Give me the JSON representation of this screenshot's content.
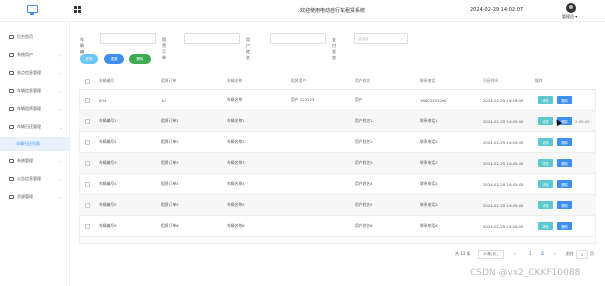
{
  "header": {
    "title": "欢迎使用电动自行车租赁系统",
    "datetime": "2024-02-29 14:02:07",
    "user": "管理员 ▾"
  },
  "sidebar": {
    "items": [
      {
        "label": "后台首页",
        "icon": "home-icon"
      },
      {
        "label": "系统用户",
        "icon": "user-icon",
        "arrow": "›"
      },
      {
        "label": "站点信息管理",
        "icon": "site-icon",
        "arrow": "›"
      },
      {
        "label": "车辆信息管理",
        "icon": "bike-icon",
        "arrow": "›"
      },
      {
        "label": "车辆租赁管理",
        "icon": "rent-icon",
        "arrow": "›"
      },
      {
        "label": "车辆归还管理",
        "icon": "return-icon",
        "arrow": "⌄"
      },
      {
        "label": "车辆归还列表",
        "sub": true
      },
      {
        "label": "系统管理",
        "icon": "settings-icon",
        "arrow": "›"
      },
      {
        "label": "公告信息管理",
        "icon": "notice-icon",
        "arrow": "›"
      },
      {
        "label": "资源管理",
        "icon": "resource-icon",
        "arrow": "›"
      }
    ]
  },
  "filters": {
    "vehicle_no_label": "车辆编号",
    "rent_no_label": "租赁订单",
    "username_label": "用户姓名",
    "pay_status_label": "支付状态",
    "pay_status_placeholder": "请选择"
  },
  "buttons": {
    "search": "查询",
    "reset": "重置",
    "delete": "删除"
  },
  "table": {
    "headers": [
      "车辆编号",
      "租赁订单",
      "车辆名称",
      "租赁用户",
      "用户姓名",
      "联系电话",
      "归还时间",
      "操作"
    ],
    "edit_label": "详情",
    "delete_label": "删除",
    "rows": [
      [
        "E04",
        "10",
        "车辆名称",
        "用户 123123",
        "用户",
        "18603253290",
        "2024-02-29 14:49:00"
      ],
      [
        "车辆编号1",
        "租赁订单1",
        "车辆名称1",
        "",
        "用户姓名1",
        "联系电话1",
        "2024-02-29 14:45:45"
      ],
      [
        "车辆编号2",
        "租赁订单2",
        "车辆名称2",
        "",
        "用户姓名2",
        "联系电话2",
        "2024-02-29 14:45:45"
      ],
      [
        "车辆编号3",
        "租赁订单3",
        "车辆名称3",
        "",
        "用户姓名3",
        "联系电话3",
        "2024-02-29 14:45:45"
      ],
      [
        "车辆编号4",
        "租赁订单4",
        "车辆名称4",
        "",
        "用户姓名4",
        "联系电话4",
        "2024-02-29 14:45:45"
      ],
      [
        "车辆编号5",
        "租赁订单5",
        "车辆名称5",
        "",
        "用户姓名5",
        "联系电话5",
        "2024-02-29 14:45:45"
      ],
      [
        "车辆编号6",
        "租赁订单6",
        "车辆名称6",
        "",
        "用户姓名6",
        "联系电话6",
        "2024-02-29 14:45:45"
      ]
    ],
    "tooltip": "2:45:45"
  },
  "pagination": {
    "total": "共 13 条",
    "page_size": "10条/页",
    "prev": "‹",
    "pages": [
      "1",
      "2"
    ],
    "next": "›",
    "goto": "前往",
    "current": "2",
    "unit": "页"
  },
  "watermark": "CSDN @vx2_CKKF10088",
  "colors": {
    "primary": "#3f8ff0",
    "search": "#6ec6f5",
    "reset": "#3f8ff0",
    "delete": "#3dab52",
    "edit": "#5ec8cf"
  }
}
